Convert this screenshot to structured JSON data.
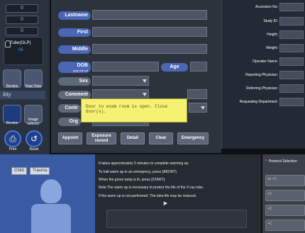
{
  "left_panel": {
    "counters": [
      "0",
      "0",
      "0"
    ],
    "tube_label": "Tube(OLP)",
    "tube_value": "05",
    "small_buttons": [
      "Review",
      "Raw Data"
    ],
    "utility_label": "ility",
    "image_buttons": [
      "Review",
      "Image selector"
    ],
    "bottom_buttons": [
      "Print",
      "Reset"
    ]
  },
  "form": {
    "fields": [
      {
        "label": "Lastname"
      },
      {
        "label": "First"
      },
      {
        "label": "Middle"
      }
    ],
    "dob_label": "DOB",
    "dob_hint": "yyyy.mm.dd",
    "age_label": "Age",
    "sex_label": "Sex",
    "comment_label": "Comment",
    "contrast_label": "Contr",
    "org_label": "Org"
  },
  "tooltip": {
    "text": "Door to exam room is open. Close door(s)."
  },
  "actions": {
    "appoint": "Appoint",
    "exposure_line1": "Exposure",
    "exposure_line2": "record",
    "detail": "Detail",
    "clear": "Clear",
    "emergency": "Emergency"
  },
  "info": {
    "labels": [
      "Accession No:",
      "Study ID:",
      "Height:",
      "Weight:",
      "Operator Name:",
      "Reporting Physician:",
      "Referring Physician:",
      "Requesting Department:"
    ]
  },
  "bottom": {
    "tab_child": "Child",
    "tab_trauma": "Trauma",
    "warmup_lines": [
      "It takes approximately 5 minutes to complete warming up.",
      "To halt warm up in an emergency, press [ABORT].",
      "When the green lamp is lit, press [START].",
      "Note:The warm up is necessary to protect the life of the X-ray tube.",
      "If the warm up is not performed. The tube life may be reduced."
    ],
    "protocol_title": "Protocol Selection",
    "protocol_items": [
      "se +C",
      "+C",
      "+C",
      "+C"
    ]
  }
}
